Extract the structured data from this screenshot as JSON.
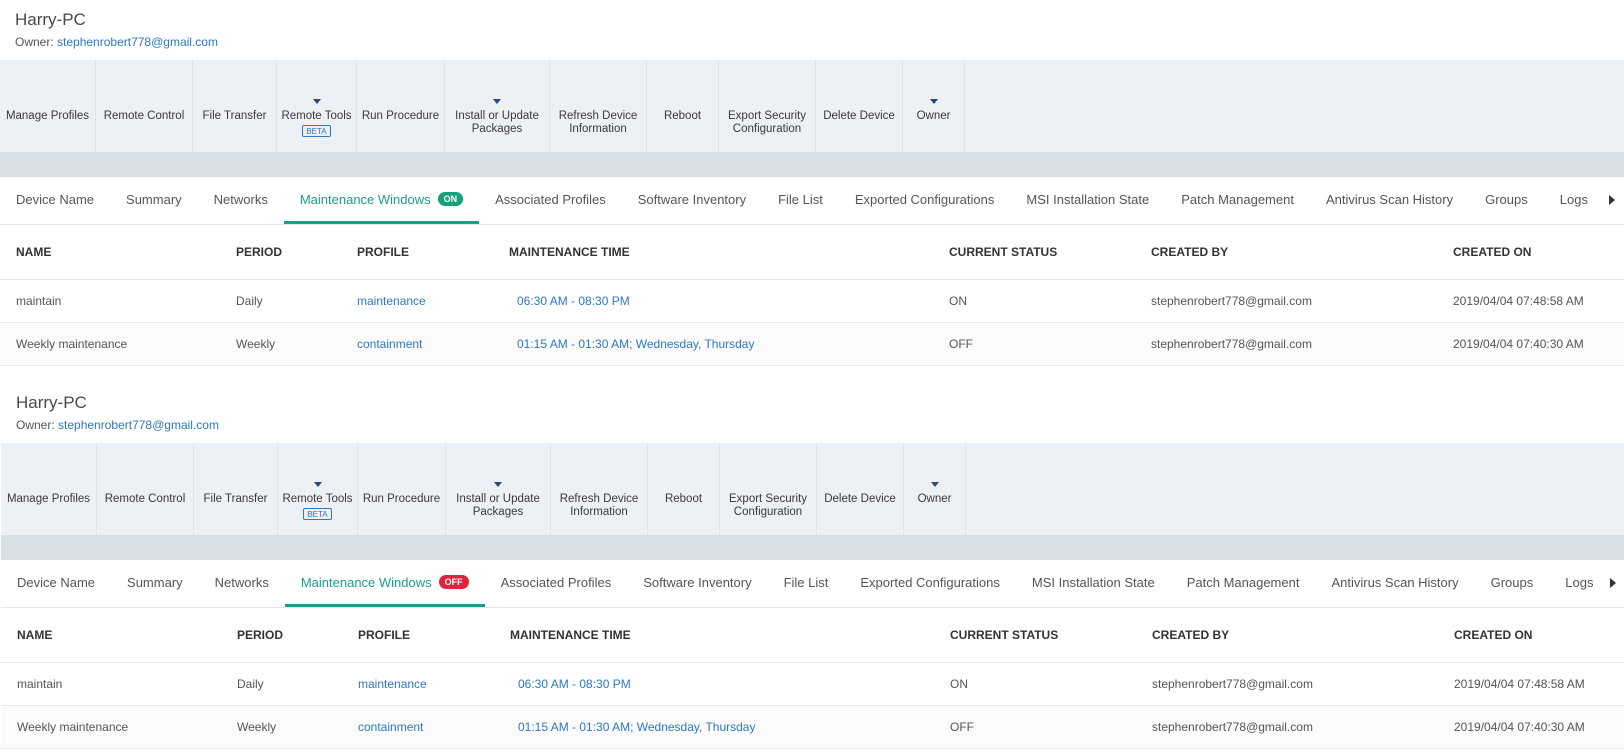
{
  "panels": [
    {
      "device_title": "Harry-PC",
      "owner_label": "Owner:",
      "owner_email": "stephenrobert778@gmail.com",
      "toolbar": [
        {
          "label": "Manage Profiles",
          "icon": "manage-profiles-icon"
        },
        {
          "label": "Remote Control",
          "icon": "laptop-icon"
        },
        {
          "label": "File Transfer",
          "icon": "file-transfer-icon"
        },
        {
          "label": "Remote Tools",
          "icon": "remote-tools-icon",
          "badge": "BETA"
        },
        {
          "label": "Run Procedure",
          "icon": "run-procedure-icon"
        },
        {
          "label": "Install or Update\nPackages",
          "icon": "package-icon"
        },
        {
          "label": "Refresh Device\nInformation",
          "icon": "refresh-icon"
        },
        {
          "label": "Reboot",
          "icon": "reboot-icon"
        },
        {
          "label": "Export Security\nConfiguration",
          "icon": "export-icon"
        },
        {
          "label": "Delete Device",
          "icon": "delete-device-icon"
        },
        {
          "label": "Owner",
          "icon": "owner-icon"
        }
      ],
      "tabs": [
        "Device Name",
        "Summary",
        "Networks",
        "Maintenance Windows",
        "Associated Profiles",
        "Software Inventory",
        "File List",
        "Exported Configurations",
        "MSI Installation State",
        "Patch Management",
        "Antivirus Scan History",
        "Groups",
        "Logs"
      ],
      "active_tab_badge": "ON",
      "table": {
        "headers": [
          "NAME",
          "PERIOD",
          "PROFILE",
          "MAINTENANCE TIME",
          "CURRENT STATUS",
          "CREATED BY",
          "CREATED ON"
        ],
        "rows": [
          [
            "maintain",
            "Daily",
            "maintenance",
            "06:30 AM - 08:30 PM",
            "ON",
            "stephenrobert778@gmail.com",
            "2019/04/04 07:48:58 AM"
          ],
          [
            "Weekly maintenance",
            "Weekly",
            "containment",
            "01:15 AM - 01:30 AM; Wednesday, Thursday",
            "OFF",
            "stephenrobert778@gmail.com",
            "2019/04/04 07:40:30 AM"
          ]
        ]
      }
    },
    {
      "device_title": "Harry-PC",
      "owner_label": "Owner:",
      "owner_email": "stephenrobert778@gmail.com",
      "toolbar": [
        {
          "label": "Manage Profiles",
          "icon": "manage-profiles-icon"
        },
        {
          "label": "Remote Control",
          "icon": "laptop-icon"
        },
        {
          "label": "File Transfer",
          "icon": "file-transfer-icon"
        },
        {
          "label": "Remote Tools",
          "icon": "remote-tools-icon",
          "badge": "BETA"
        },
        {
          "label": "Run Procedure",
          "icon": "run-procedure-icon"
        },
        {
          "label": "Install or Update\nPackages",
          "icon": "package-icon"
        },
        {
          "label": "Refresh Device\nInformation",
          "icon": "refresh-icon"
        },
        {
          "label": "Reboot",
          "icon": "reboot-icon"
        },
        {
          "label": "Export Security\nConfiguration",
          "icon": "export-icon"
        },
        {
          "label": "Delete Device",
          "icon": "delete-device-icon"
        },
        {
          "label": "Owner",
          "icon": "owner-icon"
        }
      ],
      "tabs": [
        "Device Name",
        "Summary",
        "Networks",
        "Maintenance Windows",
        "Associated Profiles",
        "Software Inventory",
        "File List",
        "Exported Configurations",
        "MSI Installation State",
        "Patch Management",
        "Antivirus Scan History",
        "Groups",
        "Logs"
      ],
      "active_tab_badge": "OFF",
      "table": {
        "headers": [
          "NAME",
          "PERIOD",
          "PROFILE",
          "MAINTENANCE TIME",
          "CURRENT STATUS",
          "CREATED BY",
          "CREATED ON"
        ],
        "rows": [
          [
            "maintain",
            "Daily",
            "maintenance",
            "06:30 AM - 08:30 PM",
            "ON",
            "stephenrobert778@gmail.com",
            "2019/04/04 07:48:58 AM"
          ],
          [
            "Weekly maintenance",
            "Weekly",
            "containment",
            "01:15 AM - 01:30 AM; Wednesday, Thursday",
            "OFF",
            "stephenrobert778@gmail.com",
            "2019/04/04 07:40:30 AM"
          ]
        ]
      }
    }
  ],
  "colors": {
    "accent_teal": "#1a9e8c",
    "link_blue": "#2e78c0",
    "badge_on": "#17a07c",
    "badge_off": "#e0223a",
    "icon_navy": "#264a7a"
  }
}
